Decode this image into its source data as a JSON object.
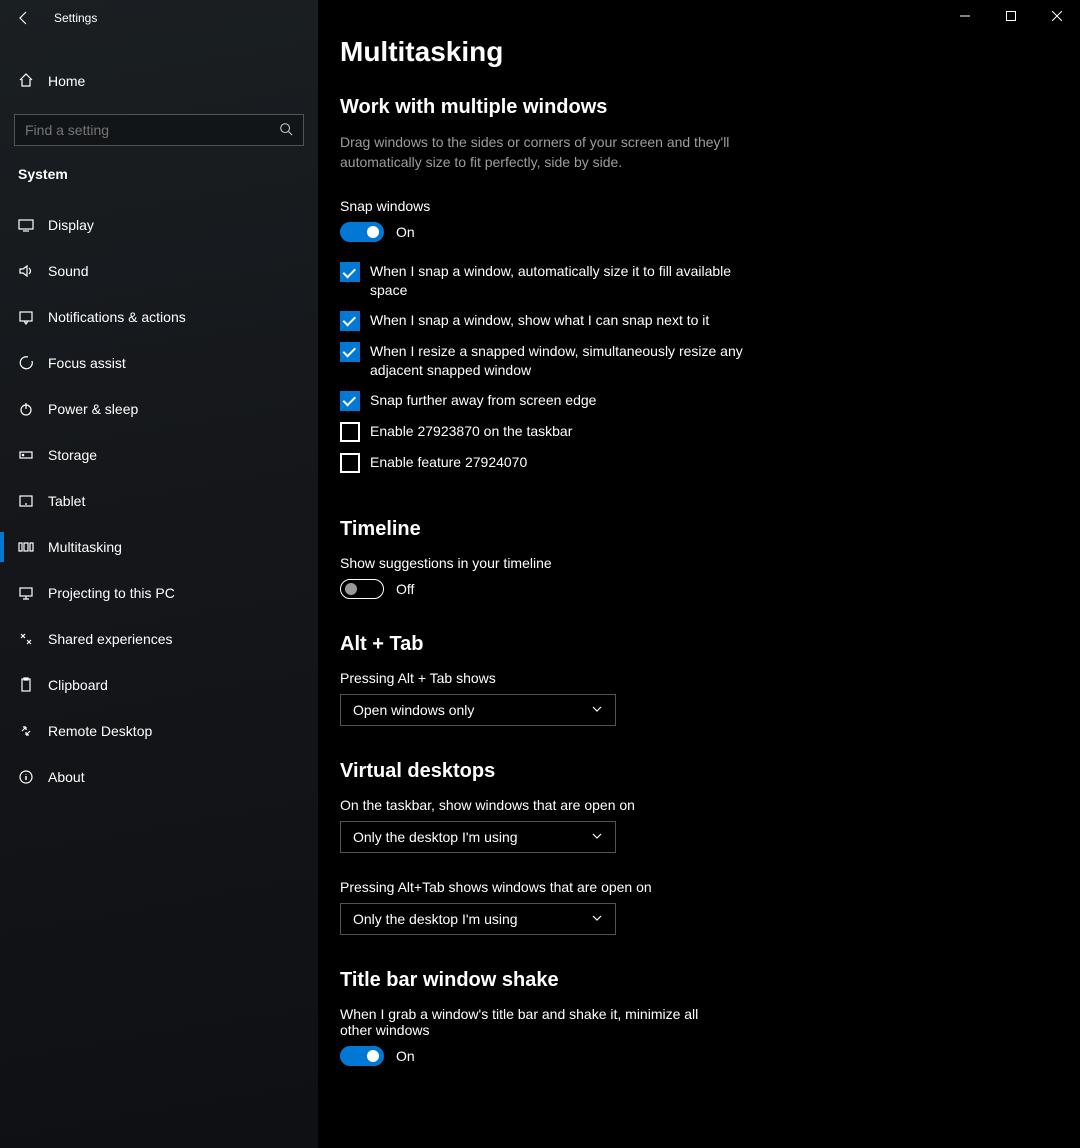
{
  "window": {
    "title": "Settings"
  },
  "sidebar": {
    "home": "Home",
    "search_placeholder": "Find a setting",
    "category": "System",
    "items": [
      {
        "id": "display",
        "label": "Display"
      },
      {
        "id": "sound",
        "label": "Sound"
      },
      {
        "id": "notifications",
        "label": "Notifications & actions"
      },
      {
        "id": "focus-assist",
        "label": "Focus assist"
      },
      {
        "id": "power-sleep",
        "label": "Power & sleep"
      },
      {
        "id": "storage",
        "label": "Storage"
      },
      {
        "id": "tablet",
        "label": "Tablet"
      },
      {
        "id": "multitasking",
        "label": "Multitasking"
      },
      {
        "id": "projecting",
        "label": "Projecting to this PC"
      },
      {
        "id": "shared-experiences",
        "label": "Shared experiences"
      },
      {
        "id": "clipboard",
        "label": "Clipboard"
      },
      {
        "id": "remote-desktop",
        "label": "Remote Desktop"
      },
      {
        "id": "about",
        "label": "About"
      }
    ]
  },
  "page": {
    "title": "Multitasking",
    "sections": {
      "work": {
        "heading": "Work with multiple windows",
        "desc": "Drag windows to the sides or corners of your screen and they'll automatically size to fit perfectly, side by side.",
        "snap_label": "Snap windows",
        "snap_state": "On",
        "checks": [
          {
            "checked": true,
            "label": "When I snap a window, automatically size it to fill available space"
          },
          {
            "checked": true,
            "label": "When I snap a window, show what I can snap next to it"
          },
          {
            "checked": true,
            "label": "When I resize a snapped window, simultaneously resize any adjacent snapped window"
          },
          {
            "checked": true,
            "label": "Snap further away from screen edge"
          },
          {
            "checked": false,
            "label": "Enable 27923870 on the taskbar"
          },
          {
            "checked": false,
            "label": "Enable feature 27924070"
          }
        ]
      },
      "timeline": {
        "heading": "Timeline",
        "label": "Show suggestions in your timeline",
        "state": "Off"
      },
      "alttab": {
        "heading": "Alt + Tab",
        "label": "Pressing Alt + Tab shows",
        "value": "Open windows only"
      },
      "virtual": {
        "heading": "Virtual desktops",
        "label1": "On the taskbar, show windows that are open on",
        "value1": "Only the desktop I'm using",
        "label2": "Pressing Alt+Tab shows windows that are open on",
        "value2": "Only the desktop I'm using"
      },
      "shake": {
        "heading": "Title bar window shake",
        "label": "When I grab a window's title bar and shake it, minimize all other windows",
        "state": "On"
      }
    }
  }
}
